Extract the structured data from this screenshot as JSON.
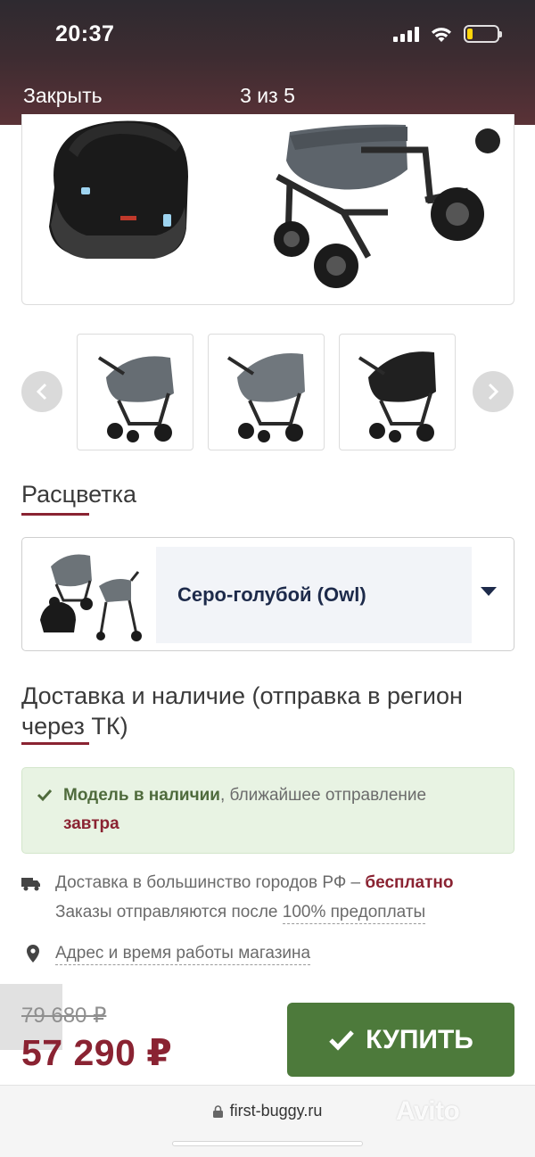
{
  "status_bar": {
    "time": "20:37"
  },
  "gallery_header": {
    "close_label": "Закрыть",
    "counter": "3 из 5"
  },
  "color_section": {
    "title": "Расцветка",
    "selected": "Серо-голубой (Owl)"
  },
  "delivery_section": {
    "title": "Доставка и наличие (отправка в регион через ТК)",
    "availability_bold": "Модель в наличии",
    "availability_rest": ", ближайшее отправление",
    "availability_day": "завтра",
    "delivery_text": "Доставка в большинство городов РФ – ",
    "delivery_free": "бесплатно",
    "orders_text": "Заказы отправляются после ",
    "orders_link": "100% предоплаты",
    "address_link": "Адрес и время работы магазина"
  },
  "pricing": {
    "old_price": "79 680 ₽",
    "new_price": "57 290 ₽",
    "buy_label": "КУПИТЬ"
  },
  "browser": {
    "url": "first-buggy.ru",
    "watermark": "Avito"
  },
  "colors": {
    "accent_red": "#8a2332",
    "buy_green": "#4d7a3b",
    "avail_bg": "#e8f3e3"
  }
}
